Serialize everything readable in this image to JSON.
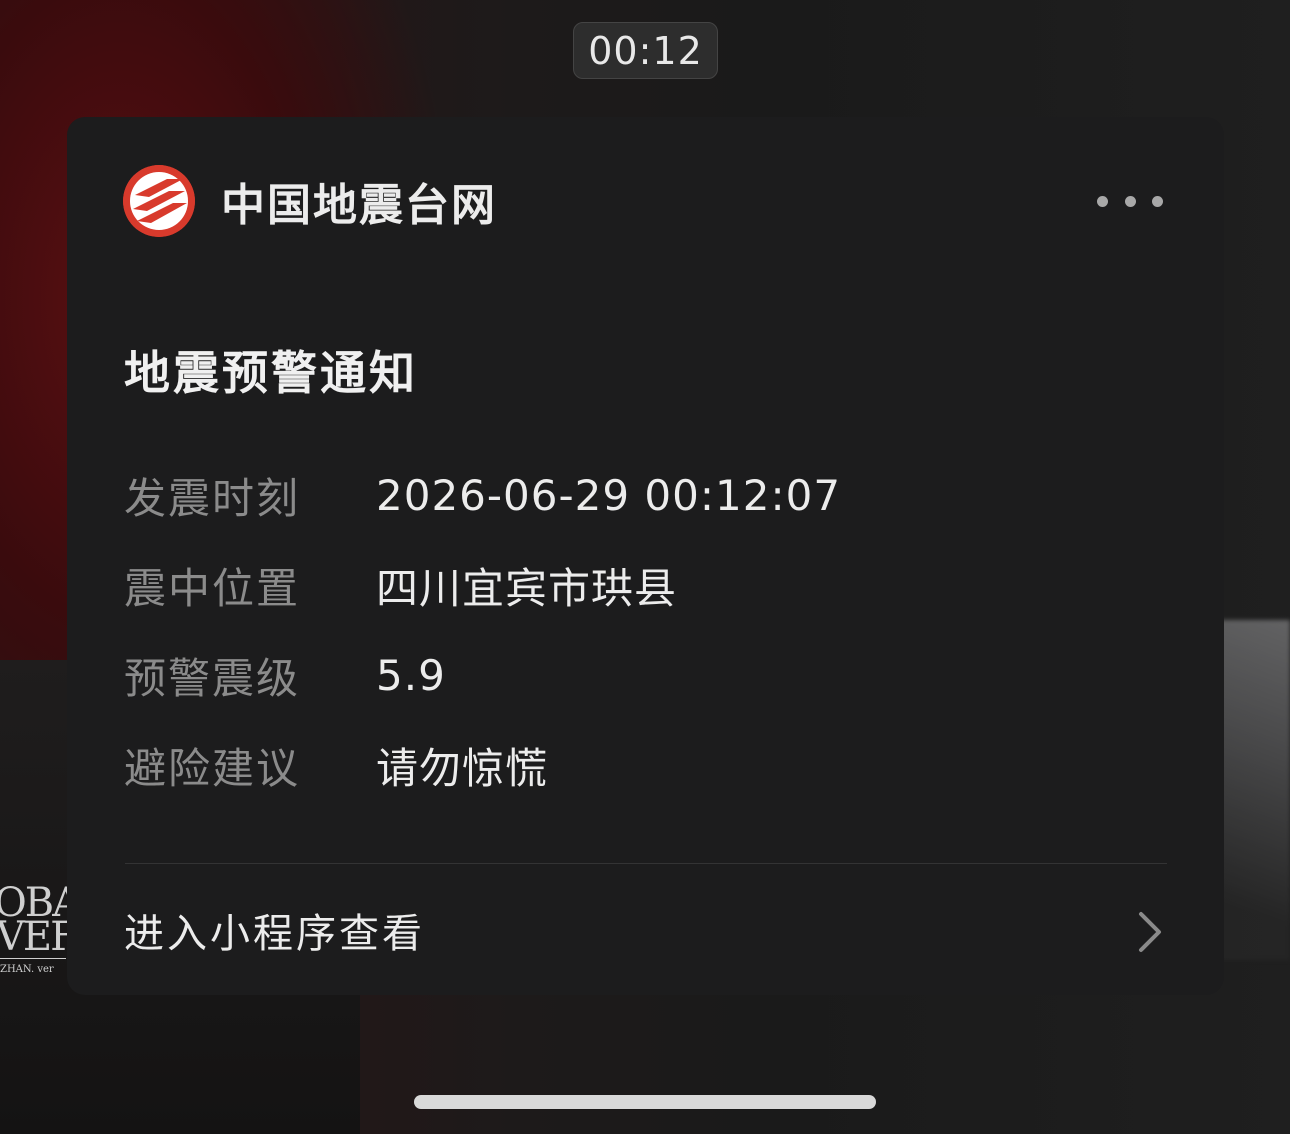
{
  "timer": "00:12",
  "app": {
    "name": "中国地震台网",
    "brand_color": "#d83a2c"
  },
  "notification": {
    "title": "地震预警通知",
    "rows": [
      {
        "label": "发震时刻",
        "value": "2026-06-29 00:12:07"
      },
      {
        "label": "震中位置",
        "value": "四川宜宾市珙县"
      },
      {
        "label": "预警震级",
        "value": "5.9"
      },
      {
        "label": "避险建议",
        "value": "请勿惊慌"
      }
    ],
    "footer_link": "进入小程序查看"
  },
  "background_poster": {
    "line1": "OBA",
    "line2": "VEF",
    "line3": "ZHAN. ver"
  },
  "icons": {
    "logo": "earthquake-network-logo-icon",
    "more": "more-dots-icon",
    "chevron": "chevron-right-icon"
  }
}
